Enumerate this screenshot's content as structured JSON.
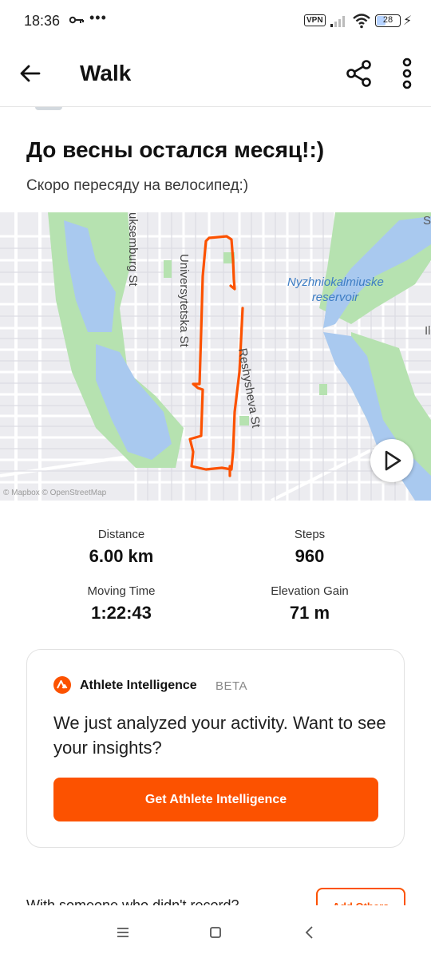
{
  "status_bar": {
    "time": "18:36",
    "dots": "•••",
    "vpn": "VPN",
    "battery": "28",
    "icons": [
      "key-icon",
      "signal-icon",
      "wifi-icon",
      "battery-icon",
      "charging-icon"
    ]
  },
  "app_bar": {
    "title": "Walk",
    "icons": [
      "back-arrow-icon",
      "share-icon",
      "more-vert-icon"
    ]
  },
  "activity": {
    "title": "До весны остался месяц!:)",
    "description": "Скоро пересяду на велосипед:)"
  },
  "map": {
    "labels": {
      "street_1": "uksemburg St",
      "street_2": "Universytetska St",
      "street_3": "Reshysheva St",
      "reservoir": "Nyzhniokalmiuske reservoir",
      "edge_1": "S",
      "edge_2": "Il",
      "attribution": "© Mapbox © OpenStreetMap"
    },
    "colors": {
      "route": "#fc5200",
      "water": "#a9c9ef",
      "park": "#b6e2b0",
      "land": "#ececf0"
    },
    "play_icon": "play-icon"
  },
  "stats": [
    {
      "label": "Distance",
      "value": "6.00 km"
    },
    {
      "label": "Steps",
      "value": "960"
    },
    {
      "label": "Moving Time",
      "value": "1:22:43"
    },
    {
      "label": "Elevation Gain",
      "value": "71 m"
    }
  ],
  "athlete_intelligence": {
    "name": "Athlete Intelligence",
    "badge": "BETA",
    "message": "We just analyzed your activity. Want to see your insights?",
    "button": "Get Athlete Intelligence",
    "accent": "#fc5200"
  },
  "bottom": {
    "question": "With someone who didn't record?",
    "add_button": "Add Others"
  },
  "nav_bar": {
    "icons": [
      "menu-icon",
      "home-square-icon",
      "back-chevron-icon"
    ]
  }
}
